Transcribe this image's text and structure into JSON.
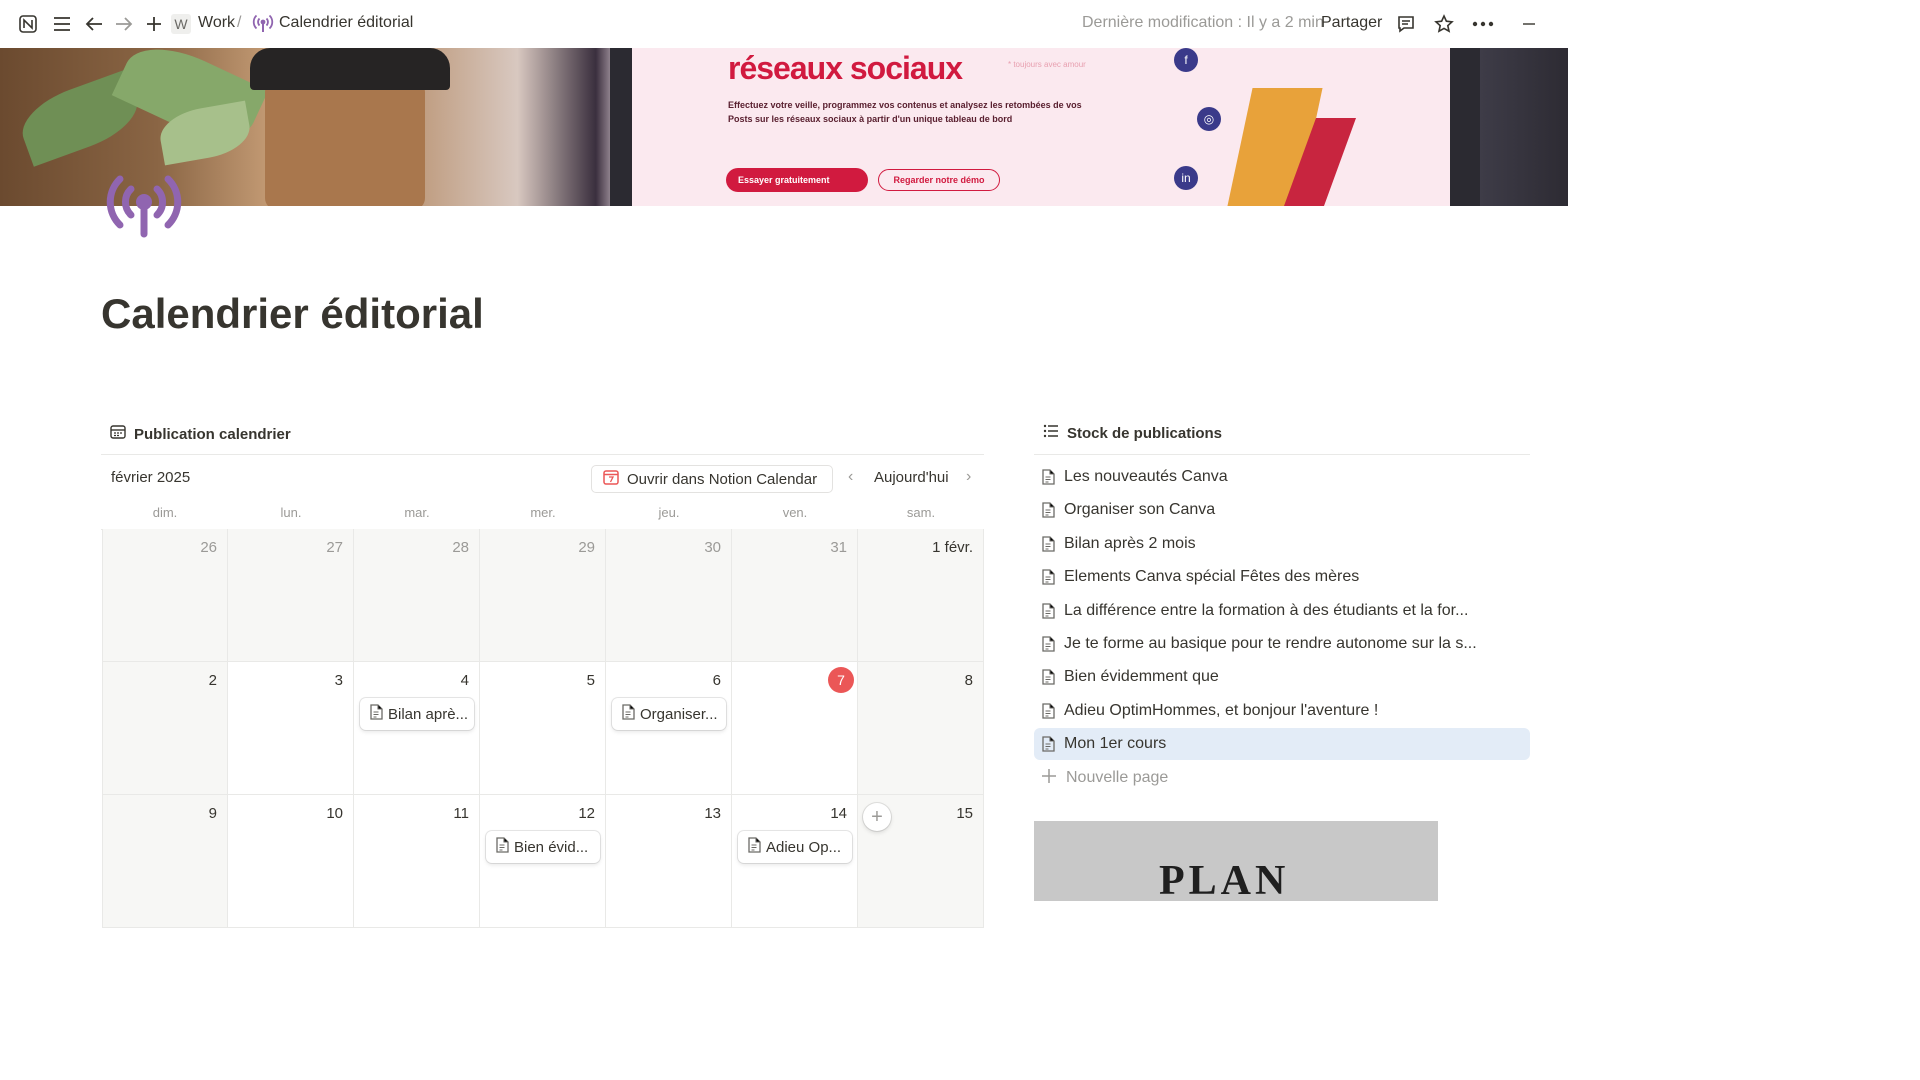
{
  "topbar": {
    "workspace_initial": "W",
    "workspace": "Work",
    "separator": "/",
    "page": "Calendrier éditorial",
    "last_modified": "Dernière modification : Il y a 2 min",
    "share": "Partager",
    "icons": [
      "notion-logo-icon",
      "menu-icon",
      "back-arrow-icon",
      "forward-arrow-icon",
      "plus-icon",
      "comment-icon",
      "star-icon",
      "more-icon",
      "minimize-icon"
    ]
  },
  "cover": {
    "headline": "réseaux sociaux",
    "tagline": "* toujours avec amour",
    "description": "Effectuez votre veille, programmez vos contenus et analysez les retombées de vos Posts sur les réseaux sociaux à partir d'un unique tableau de bord",
    "cta_primary": "Essayer gratuitement",
    "cta_secondary": "Regarder notre démo"
  },
  "page": {
    "icon": "broadcast-icon",
    "icon_color": "#9065b0",
    "title": "Calendrier éditorial"
  },
  "calendar": {
    "view_title": "Publication calendrier",
    "month": "février 2025",
    "open_button": "Ouvrir dans Notion Calendar",
    "today_button": "Aujourd'hui",
    "weekdays": [
      "dim.",
      "lun.",
      "mar.",
      "mer.",
      "jeu.",
      "ven.",
      "sam."
    ],
    "rows": [
      [
        {
          "d": "26",
          "other": true,
          "gray": true
        },
        {
          "d": "27",
          "other": true,
          "gray": true
        },
        {
          "d": "28",
          "other": true,
          "gray": true
        },
        {
          "d": "29",
          "other": true,
          "gray": true
        },
        {
          "d": "30",
          "other": true,
          "gray": true
        },
        {
          "d": "31",
          "other": true,
          "gray": true
        },
        {
          "d": "1 févr.",
          "other": false,
          "gray": true
        }
      ],
      [
        {
          "d": "2",
          "gray": true
        },
        {
          "d": "3"
        },
        {
          "d": "4",
          "event": "Bilan aprè..."
        },
        {
          "d": "5"
        },
        {
          "d": "6",
          "event": "Organiser..."
        },
        {
          "d": "7",
          "today": true
        },
        {
          "d": "8",
          "gray": true
        }
      ],
      [
        {
          "d": "9",
          "gray": true
        },
        {
          "d": "10"
        },
        {
          "d": "11"
        },
        {
          "d": "12",
          "event": "Bien évid..."
        },
        {
          "d": "13"
        },
        {
          "d": "14",
          "event": "Adieu Op..."
        },
        {
          "d": "15",
          "gray": true
        }
      ]
    ],
    "today_color": "#eb5757"
  },
  "stock": {
    "title": "Stock de publications",
    "items": [
      "Les nouveautés Canva",
      "Organiser son Canva",
      "Bilan après 2 mois",
      "Elements Canva spécial Fêtes des mères",
      "La différence entre la formation à des étudiants et la for...",
      "Je te forme au basique pour te rendre autonome sur la s...",
      "Bien évidemment que",
      "Adieu OptimHommes, et bonjour l'aventure !",
      "Mon 1er cours"
    ],
    "selected_index": 8,
    "new_page": "Nouvelle page",
    "thumbnail_text": "PLAN"
  }
}
